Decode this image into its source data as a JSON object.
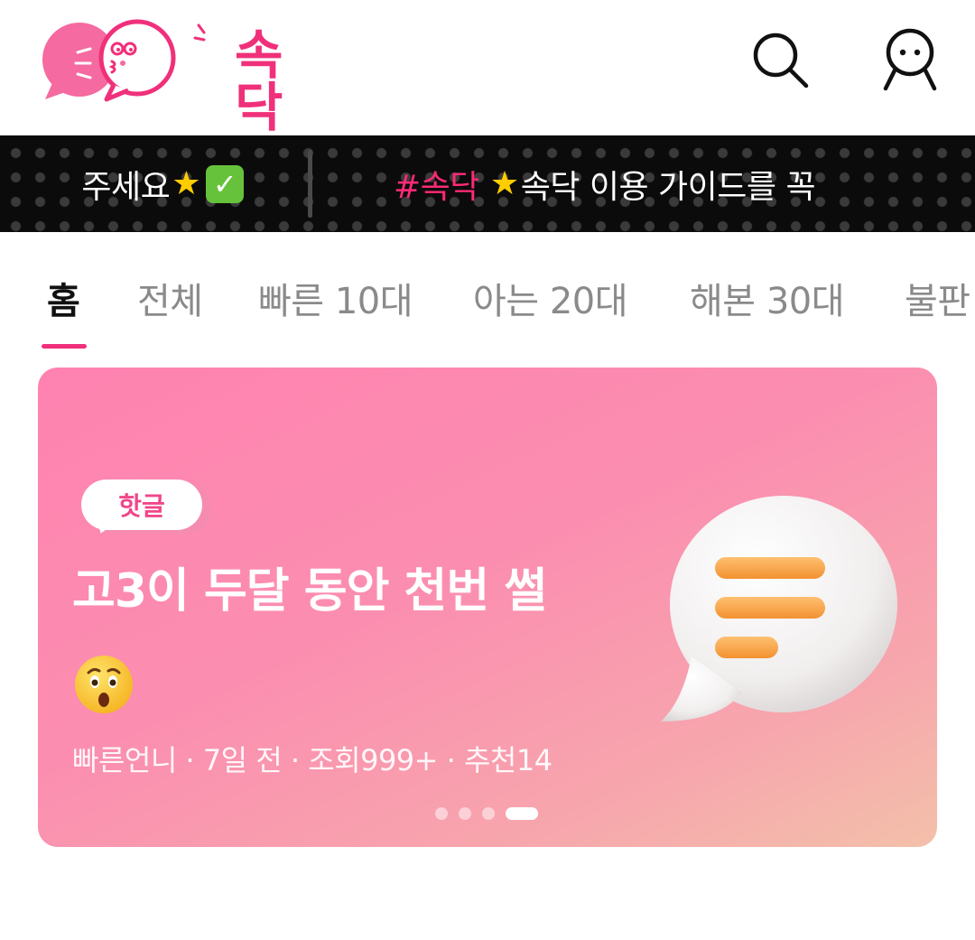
{
  "app": {
    "logo_text": "속닥"
  },
  "header": {
    "search_icon": "search-icon",
    "profile_icon": "profile-icon"
  },
  "ticker": {
    "left_text": "주세요",
    "right_hashtag": "#속닥",
    "right_text": "속닥 이용 가이드를 꼭"
  },
  "tabs": [
    {
      "label": "홈",
      "active": true
    },
    {
      "label": "전체",
      "active": false
    },
    {
      "label": "빠른 10대",
      "active": false
    },
    {
      "label": "아는 20대",
      "active": false
    },
    {
      "label": "해본 30대",
      "active": false
    },
    {
      "label": "불판",
      "active": false
    }
  ],
  "banner": {
    "badge": "핫글",
    "title": "고3이 두달 동안 천번 썰",
    "meta": "빠른언니 · 7일 전 · 조회999+ · 추천14",
    "slide_count": 4,
    "active_slide": 4
  },
  "colors": {
    "brand": "#f0307a",
    "ticker_bg": "#0b0b0b",
    "banner_start": "#ff82b0",
    "banner_end": "#f3c0aa"
  }
}
